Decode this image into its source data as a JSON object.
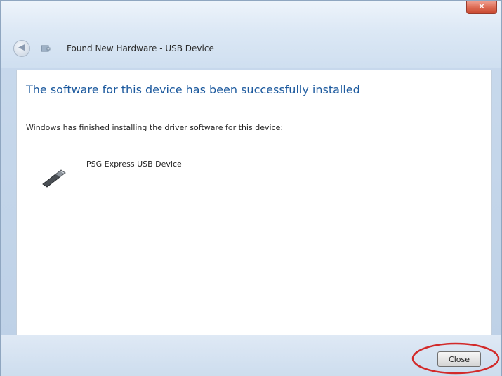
{
  "window": {
    "title": "Found New Hardware - USB Device",
    "close_glyph": "✕",
    "back_glyph": "◀"
  },
  "content": {
    "heading": "The software for this device has been successfully installed",
    "subtext": "Windows has finished installing the driver software for this device:",
    "device_name": "PSG Express USB Device"
  },
  "footer": {
    "close_label": "Close"
  },
  "icons": {
    "back": "back-arrow-icon",
    "title": "hardware-wizard-icon",
    "device": "usb-device-icon",
    "close": "close-icon"
  },
  "colors": {
    "heading": "#1d5a9e",
    "annotation": "#d22a2a",
    "close_button": "#dc6a52"
  }
}
